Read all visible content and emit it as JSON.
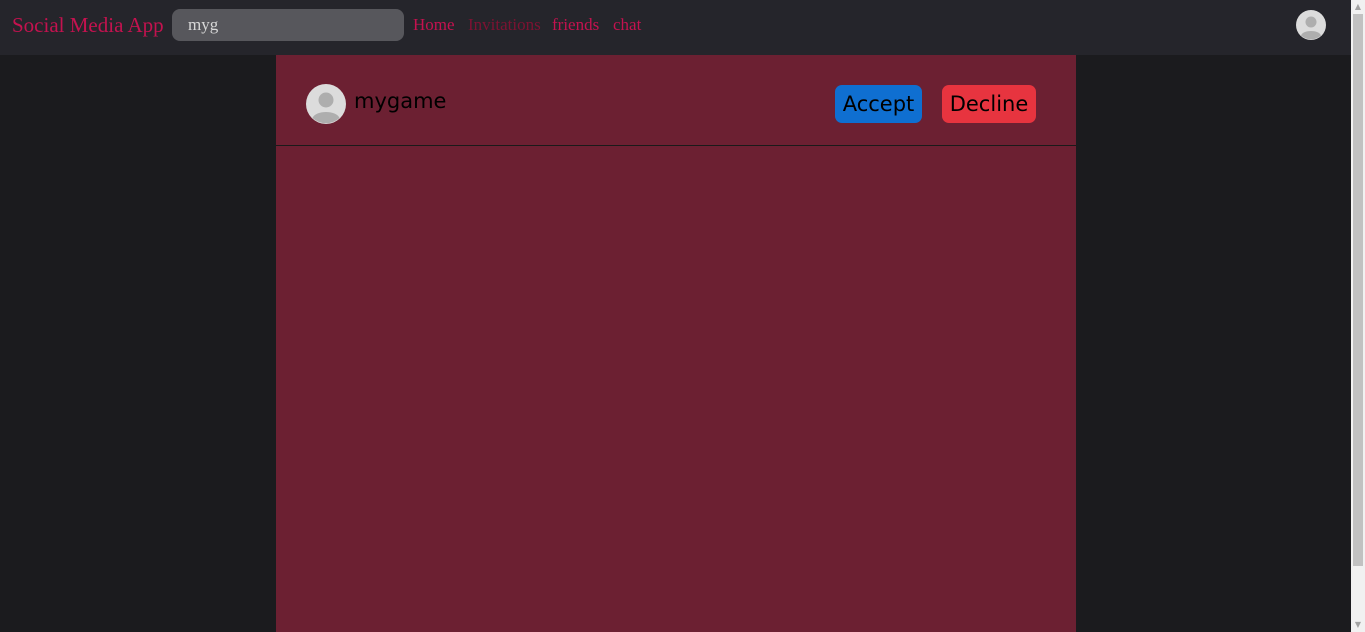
{
  "navbar": {
    "brand": "Social Media App",
    "search_value": "myg",
    "links": [
      {
        "label": "Home",
        "active": false
      },
      {
        "label": "Invitations",
        "active": true
      },
      {
        "label": "friends",
        "active": false
      },
      {
        "label": "chat",
        "active": false
      }
    ],
    "avatar_icon": "user-avatar-icon"
  },
  "invitations": [
    {
      "name": "mygame",
      "avatar_icon": "user-avatar-icon",
      "accept_label": "Accept",
      "decline_label": "Decline"
    }
  ],
  "colors": {
    "brand": "#c4124f",
    "active_link": "#7d1232",
    "panel": "#6c2032",
    "accept": "#0f6fd1",
    "decline": "#e7343f"
  }
}
